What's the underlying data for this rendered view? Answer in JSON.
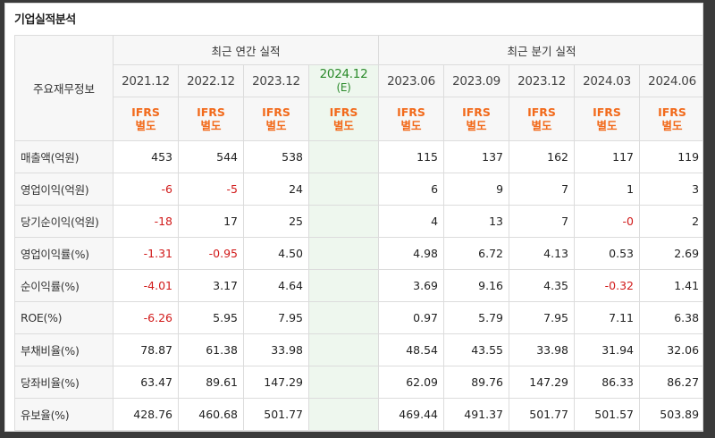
{
  "title": "기업실적분석",
  "header": {
    "corner_label": "주요재무정보",
    "annual_group": "최근 연간 실적",
    "quarter_group": "최근 분기 실적",
    "periods": [
      "2021.12",
      "2022.12",
      "2023.12",
      "2024.12",
      "2023.06",
      "2023.09",
      "2023.12",
      "2024.03",
      "2024.06"
    ],
    "estimate_marker": "(E)",
    "ifrs_line1": "IFRS",
    "ifrs_line2": "별도"
  },
  "rows": [
    {
      "label": "매출액(억원)",
      "values": [
        "453",
        "544",
        "538",
        "",
        "115",
        "137",
        "162",
        "117",
        "119"
      ]
    },
    {
      "label": "영업이익(억원)",
      "values": [
        "-6",
        "-5",
        "24",
        "",
        "6",
        "9",
        "7",
        "1",
        "3"
      ]
    },
    {
      "label": "당기순이익(억원)",
      "values": [
        "-18",
        "17",
        "25",
        "",
        "4",
        "13",
        "7",
        "-0",
        "2"
      ]
    },
    {
      "label": "영업이익률(%)",
      "values": [
        "-1.31",
        "-0.95",
        "4.50",
        "",
        "4.98",
        "6.72",
        "4.13",
        "0.53",
        "2.69"
      ]
    },
    {
      "label": "순이익률(%)",
      "values": [
        "-4.01",
        "3.17",
        "4.64",
        "",
        "3.69",
        "9.16",
        "4.35",
        "-0.32",
        "1.41"
      ]
    },
    {
      "label": "ROE(%)",
      "values": [
        "-6.26",
        "5.95",
        "7.95",
        "",
        "0.97",
        "5.79",
        "7.95",
        "7.11",
        "6.38"
      ]
    },
    {
      "label": "부채비율(%)",
      "values": [
        "78.87",
        "61.38",
        "33.98",
        "",
        "48.54",
        "43.55",
        "33.98",
        "31.94",
        "32.06"
      ]
    },
    {
      "label": "당좌비율(%)",
      "values": [
        "63.47",
        "89.61",
        "147.29",
        "",
        "62.09",
        "89.76",
        "147.29",
        "86.33",
        "86.27"
      ]
    },
    {
      "label": "유보율(%)",
      "values": [
        "428.76",
        "460.68",
        "501.77",
        "",
        "469.44",
        "491.37",
        "501.77",
        "501.57",
        "503.89"
      ]
    }
  ],
  "colors": {
    "negative": "#d11a1a",
    "ifrs": "#f26a1b",
    "estimate_bg": "#eef7ee"
  }
}
